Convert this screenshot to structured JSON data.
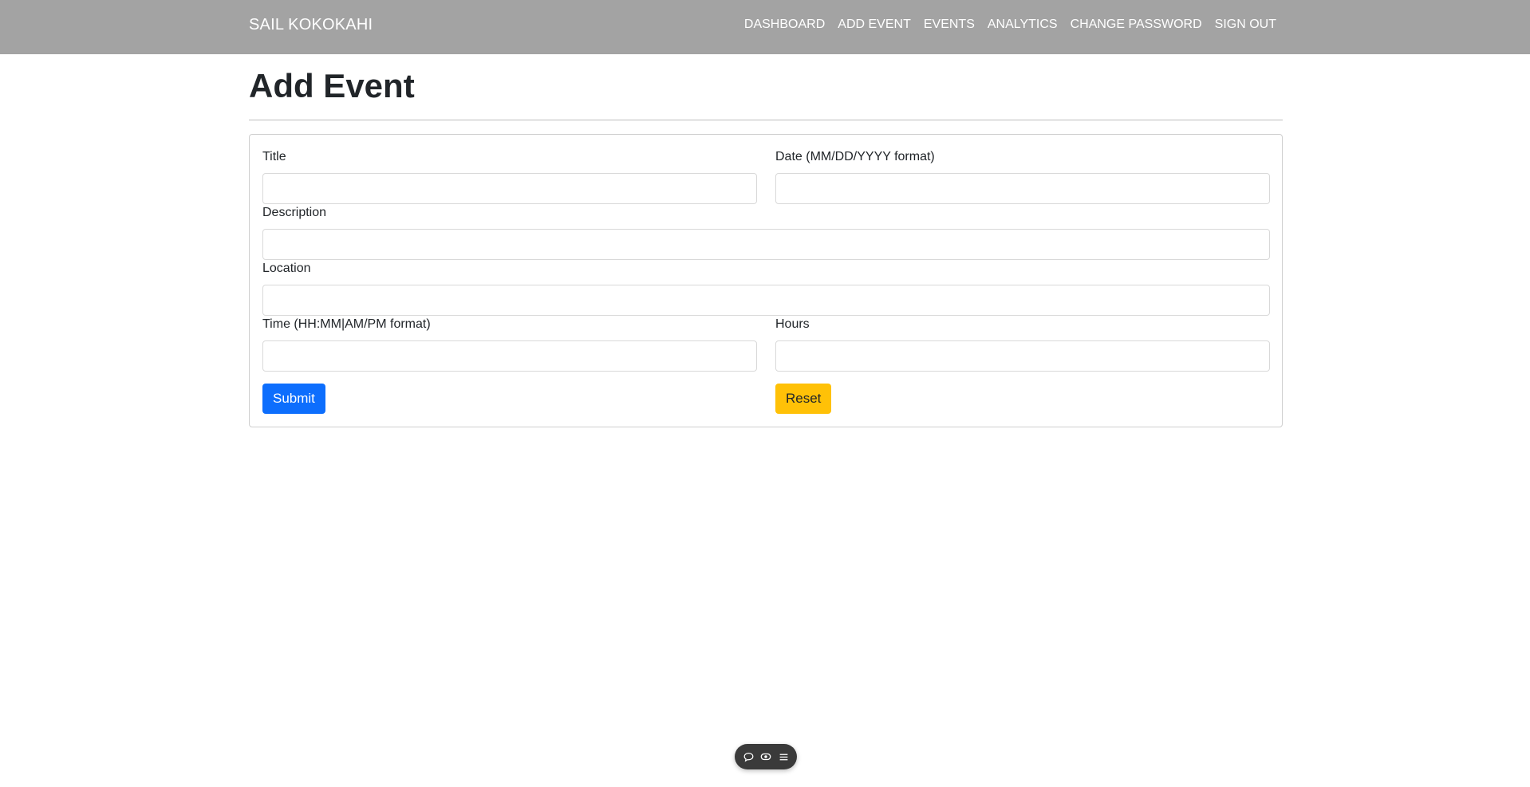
{
  "navbar": {
    "brand": "SAIL KOKOKAHI",
    "links": [
      "DASHBOARD",
      "ADD EVENT",
      "EVENTS",
      "ANALYTICS",
      "CHANGE PASSWORD",
      "SIGN OUT"
    ]
  },
  "page": {
    "title": "Add Event"
  },
  "form": {
    "title_label": "Title",
    "title_value": "",
    "date_label": "Date (MM/DD/YYYY format)",
    "date_value": "",
    "description_label": "Description",
    "description_value": "",
    "location_label": "Location",
    "location_value": "",
    "time_label": "Time (HH:MM|AM/PM format)",
    "time_value": "",
    "hours_label": "Hours",
    "hours_value": "",
    "submit_label": "Submit",
    "reset_label": "Reset"
  },
  "colors": {
    "navbar_bg": "#a3a3a3",
    "submit_bg": "#0d6efd",
    "reset_bg": "#ffc107"
  },
  "floating_toolbar": {
    "icons": [
      "comment-icon",
      "eye-icon",
      "menu-icon"
    ]
  }
}
